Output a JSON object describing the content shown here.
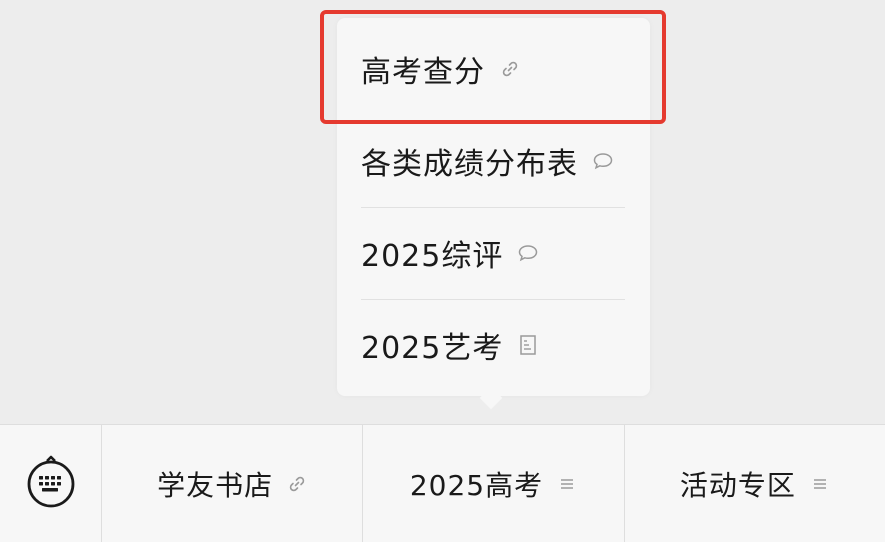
{
  "menu": {
    "items": [
      {
        "label": "高考查分",
        "icon": "link-icon"
      },
      {
        "label": "各类成绩分布表",
        "icon": "chat-bubble-icon"
      },
      {
        "label": "2025综评",
        "icon": "chat-bubble-icon"
      },
      {
        "label": "2025艺考",
        "icon": "document-icon"
      }
    ]
  },
  "bottom_bar": {
    "keyboard_icon": "keyboard-icon",
    "tabs": [
      {
        "label": "学友书店",
        "icon": "link-icon"
      },
      {
        "label": "2025高考",
        "icon": "menu-lines-icon"
      },
      {
        "label": "活动专区",
        "icon": "menu-lines-icon"
      }
    ]
  },
  "colors": {
    "highlight": "#e53a2f",
    "background": "#ededed",
    "panel": "#f7f7f7"
  }
}
